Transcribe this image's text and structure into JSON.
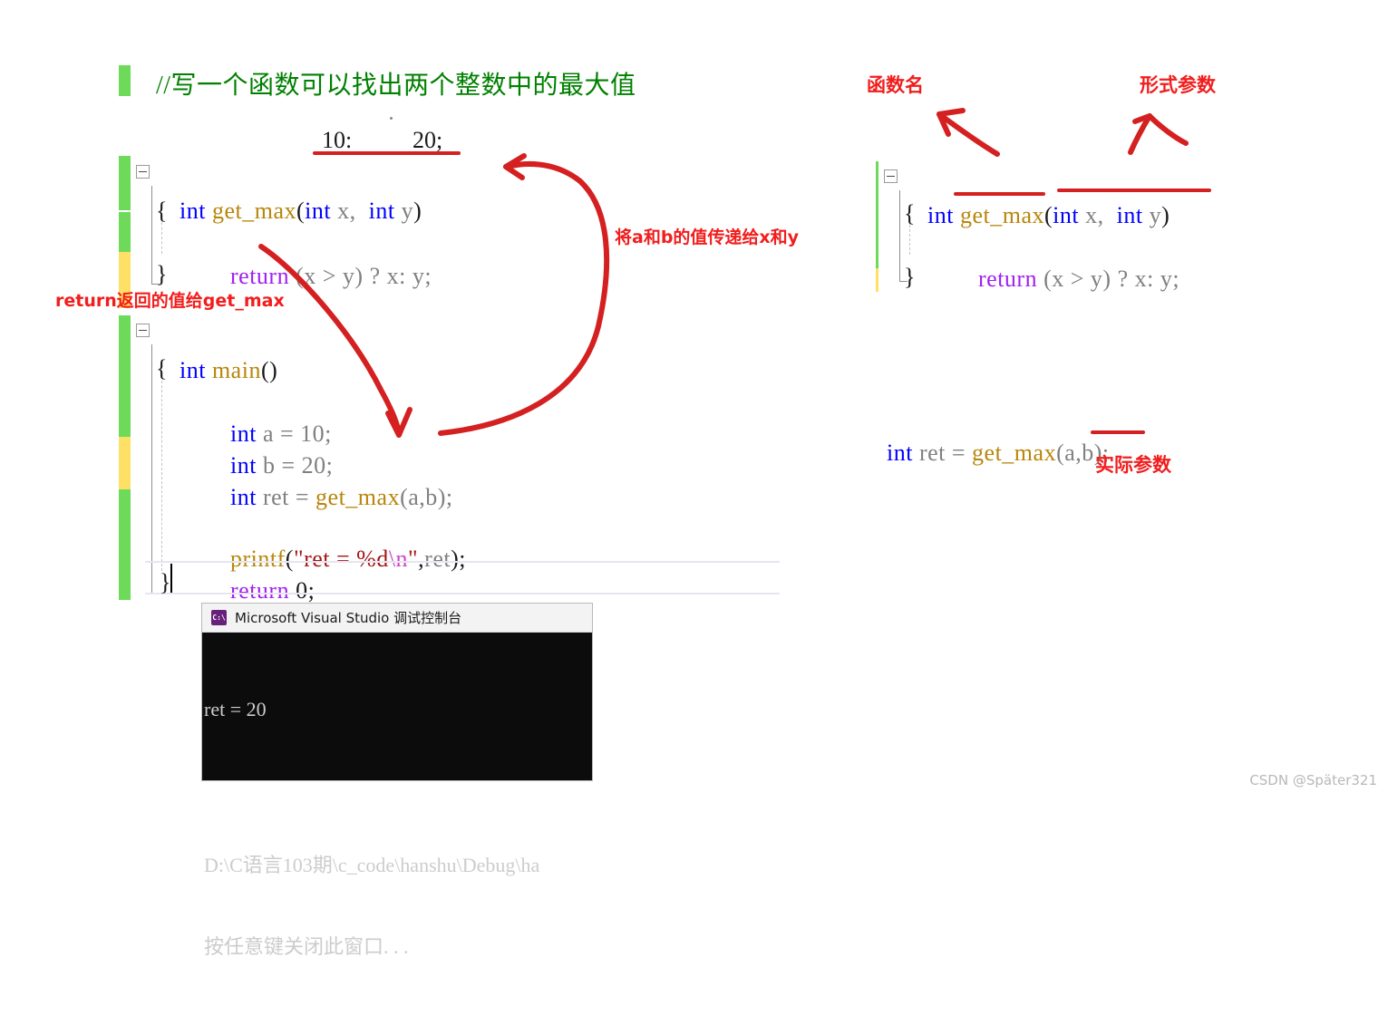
{
  "comment": {
    "text": "//写一个函数可以找出两个整数中的最大值"
  },
  "value_note": {
    "left": "10:",
    "right": "20;"
  },
  "left_code": {
    "func_line": {
      "kw": "int",
      "sp1": " ",
      "name": "get_max",
      "paren_open": "(",
      "t1": "int",
      "v1": " x,  ",
      "t2": "int",
      "v2": " y",
      "paren_close": ")"
    },
    "open_brace": "{",
    "return_line": {
      "kw": "return",
      "expr": " (x > y) ? x: y;"
    },
    "close_brace": "}",
    "main_line": {
      "kw": "int",
      "name": " main",
      "parens": "()"
    },
    "main_open": "{",
    "decl_a": {
      "kw": "int",
      "rest": " a = 10;"
    },
    "decl_b": {
      "kw": "int",
      "rest": " b = 20;"
    },
    "decl_ret": {
      "kw": "int",
      "mid": " ret = ",
      "fn": "get_max",
      "args": "(a,b);"
    },
    "printf_line": {
      "fn": "printf",
      "p1": "(",
      "q1": "\"",
      "s1": "ret = %d",
      "esc": "\\n",
      "q2": "\"",
      "comma": ",",
      "arg": "ret",
      "p2": ");"
    },
    "return_zero": {
      "kw": "return",
      "rest": " 0;"
    },
    "main_close": "}"
  },
  "right_code": {
    "label_funcname": "函数名",
    "label_formal": "形式参数",
    "func_line": {
      "kw": "int",
      "sp1": " ",
      "name": "get_max",
      "paren_open": "(",
      "t1": "int",
      "v1": " x,  ",
      "t2": "int",
      "v2": " y",
      "paren_close": ")"
    },
    "open_brace": "{",
    "return_line": {
      "kw": "return",
      "expr": " (x > y) ? x: y;"
    },
    "close_brace": "}",
    "call_line": {
      "kw": "int",
      "mid": " ret = ",
      "fn": "get_max",
      "args": "(a,b);"
    },
    "label_actual": "实际参数"
  },
  "annotations": {
    "pass_values": "将a和b的值传递给x和y",
    "return_to_getmax": "return返回的值给get_max"
  },
  "console": {
    "title": "Microsoft Visual Studio 调试控制台",
    "icon_label": "C:\\",
    "output_line": "ret = 20",
    "path_line": "D:\\C语言103期\\c_code\\hanshu\\Debug\\ha",
    "prompt_line": "按任意键关闭此窗口. . ."
  },
  "watermark": "CSDN @Später321",
  "colors": {
    "keyword": "#0000FF",
    "function": "#B8860B",
    "return_keyword": "#A020F0",
    "comment": "#008000",
    "string": "#A31515",
    "annotation_red": "#F21D1D",
    "marker_red": "#D42020",
    "changebar_green": "#6DDB59",
    "changebar_yellow": "#FFE066"
  }
}
